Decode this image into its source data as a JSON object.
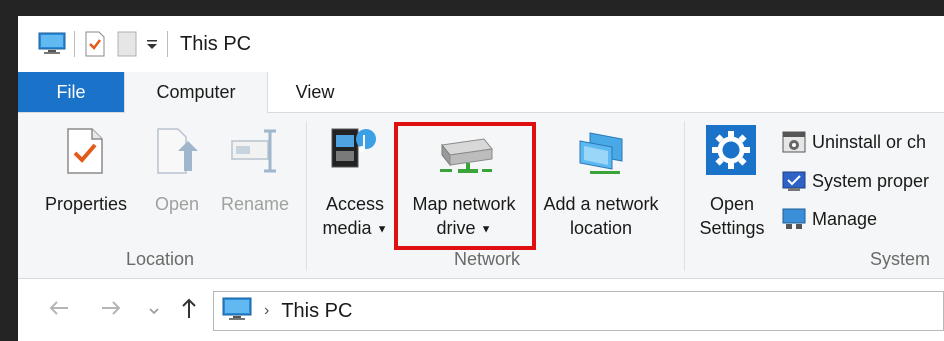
{
  "window": {
    "title": "This PC"
  },
  "tabs": [
    {
      "label": "File"
    },
    {
      "label": "Computer"
    },
    {
      "label": "View"
    }
  ],
  "ribbon": {
    "groups": {
      "location": {
        "label": "Location"
      },
      "network": {
        "label": "Network"
      },
      "system": {
        "label": "System"
      }
    },
    "buttons": {
      "properties": "Properties",
      "open": "Open",
      "rename": "Rename",
      "access_media_l1": "Access",
      "access_media_l2": "media",
      "map_drive_l1": "Map network",
      "map_drive_l2": "drive",
      "add_location_l1": "Add a network",
      "add_location_l2": "location",
      "open_settings_l1": "Open",
      "open_settings_l2": "Settings"
    },
    "system_items": {
      "uninstall": "Uninstall or ch",
      "system_properties": "System proper",
      "manage": "Manage"
    }
  },
  "address": {
    "crumb": "This PC",
    "separator": "›"
  },
  "colors": {
    "file_tab": "#1a73c9",
    "highlight": "#e01010"
  }
}
